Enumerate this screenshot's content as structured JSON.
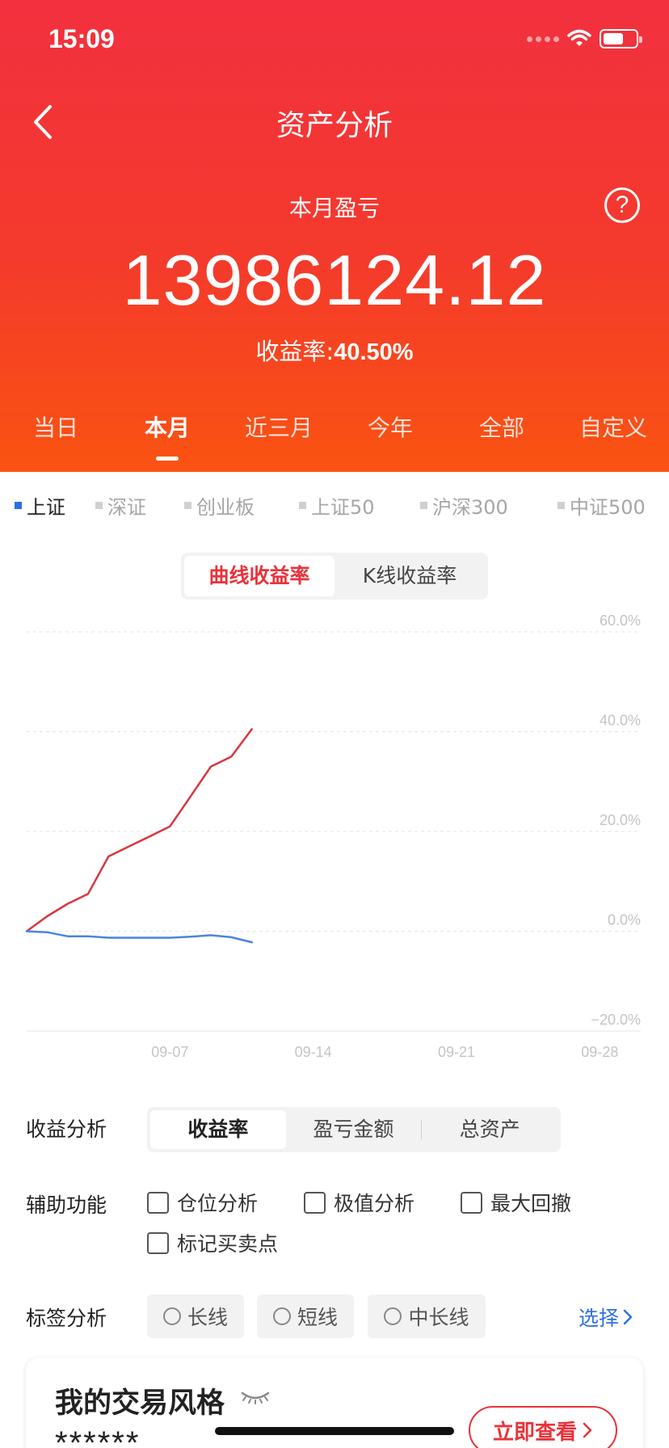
{
  "status_bar": {
    "time": "15:09"
  },
  "nav": {
    "title": "资产分析"
  },
  "summary": {
    "label": "本月盈亏",
    "amount": "13986124.12",
    "yield_label": "收益率:",
    "yield_value": "40.50%",
    "help_symbol": "?"
  },
  "period_tabs": [
    {
      "label": "当日"
    },
    {
      "label": "本月",
      "active": true
    },
    {
      "label": "近三月"
    },
    {
      "label": "今年"
    },
    {
      "label": "全部"
    },
    {
      "label": "自定义"
    }
  ],
  "index_tabs": [
    {
      "label": "上证",
      "active": true
    },
    {
      "label": "深证"
    },
    {
      "label": "创业板"
    },
    {
      "label": "上证50"
    },
    {
      "label": "沪深300"
    },
    {
      "label": "中证500"
    }
  ],
  "curve_toggle": [
    {
      "label": "曲线收益率",
      "active": true
    },
    {
      "label": "K线收益率"
    }
  ],
  "chart_data": {
    "type": "line",
    "y_ticks": [
      "60.0%",
      "40.0%",
      "20.0%",
      "0.0%",
      "−20.0%"
    ],
    "ylim": [
      -20,
      60
    ],
    "x_ticks": [
      "09-07",
      "09-14",
      "09-21",
      "09-28"
    ],
    "x_tick_days": [
      7,
      14,
      21,
      28
    ],
    "xlim": [
      0,
      30
    ],
    "grid": true,
    "colors": {
      "portfolio": "#d9363e",
      "index": "#4a84e0"
    },
    "series": [
      {
        "x": [
          0,
          1,
          2,
          3,
          4,
          5,
          6,
          7,
          8,
          9,
          10,
          11
        ],
        "values": [
          0,
          3,
          5.5,
          7.5,
          15,
          17,
          19,
          21,
          27,
          33,
          35,
          40.5
        ]
      },
      {
        "x": [
          0,
          1,
          2,
          3,
          4,
          5,
          6,
          7,
          8,
          9,
          10,
          11
        ],
        "values": [
          0,
          -0.2,
          -1,
          -1,
          -1.3,
          -1.3,
          -1.3,
          -1.3,
          -1.1,
          -0.8,
          -1.2,
          -2.2
        ]
      }
    ]
  },
  "analysis": {
    "label": "收益分析",
    "segments": [
      {
        "label": "收益率",
        "active": true
      },
      {
        "label": "盈亏金额"
      },
      {
        "label": "总资产"
      }
    ]
  },
  "aux": {
    "label": "辅助功能",
    "options": [
      "仓位分析",
      "极值分析",
      "最大回撤",
      "标记买卖点"
    ]
  },
  "tags": {
    "label": "标签分析",
    "chips": [
      "长线",
      "短线",
      "中长线"
    ],
    "select_label": "选择"
  },
  "style_card": {
    "title": "我的交易风格",
    "masked": "******",
    "button_label": "立即查看"
  }
}
